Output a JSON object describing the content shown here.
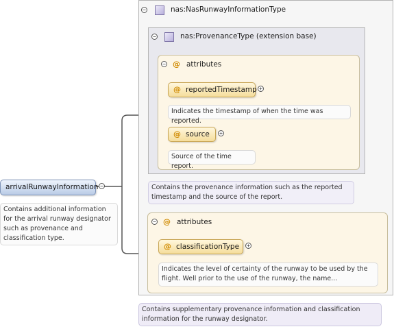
{
  "outer_type": {
    "name": "nas:NasRunwayInformationType"
  },
  "provenance_type": {
    "name": "nas:ProvenanceType (extension base)"
  },
  "attributes_group_1": {
    "label": "attributes",
    "items": [
      {
        "name": "reportedTimestamp",
        "doc": "Indicates the timestamp of when the time was reported."
      },
      {
        "name": "source",
        "doc": "Source of the time report."
      }
    ]
  },
  "provenance_doc": "Contains the provenance information such as the reported timestamp and the source of the report.",
  "attributes_group_2": {
    "label": "attributes",
    "items": [
      {
        "name": "classificationType",
        "doc": "Indicates the level of certainty of the runway to be used by the flight. Well prior to the use of the runway, the name..."
      }
    ]
  },
  "outer_type_doc": "Contains supplementary provenance information and classification information for the runway designator.",
  "element": {
    "name": "arrivalRunwayInformation",
    "doc": "Contains additional information for the arrival runway designator such as provenance and classification type."
  }
}
